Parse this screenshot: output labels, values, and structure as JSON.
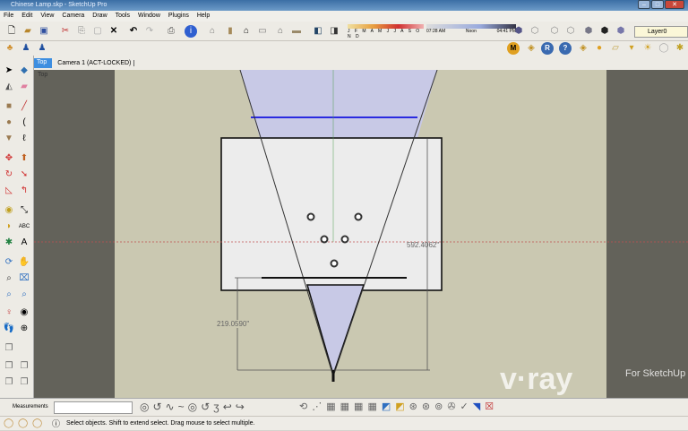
{
  "window": {
    "title": "Chinese Lamp.skp - SketchUp Pro",
    "min": "–",
    "max": "□",
    "close": "✕"
  },
  "menu": [
    "File",
    "Edit",
    "View",
    "Camera",
    "Draw",
    "Tools",
    "Window",
    "Plugins",
    "Help"
  ],
  "shadow": {
    "months": "J F M A M J J A S O N D",
    "time_start": "07:28 AM",
    "time_mid": "Noon",
    "time_end": "04:41 PM"
  },
  "layer": {
    "value": "Layer0"
  },
  "tabs": [
    {
      "label": "Top",
      "active": true
    },
    {
      "label": "Camera 1 (ACT-LOCKED)",
      "active": false
    }
  ],
  "viewport": {
    "view_label": "Top",
    "dimension_1": "219.0590\"",
    "dimension_2": "592.4062\"",
    "watermark_main": "v·ray",
    "watermark_sub": "For SketchUp"
  },
  "measurements": {
    "label": "Measurements",
    "value": ""
  },
  "status": {
    "text": "Select objects. Shift to extend select. Drag mouse to select multiple."
  },
  "colors": {
    "lamp_fill": "#c8c9e6",
    "section_line": "#2a2ae0",
    "red_axis": "#d04040",
    "green_axis": "#50a050",
    "tab_active": "#3d8ee0"
  }
}
